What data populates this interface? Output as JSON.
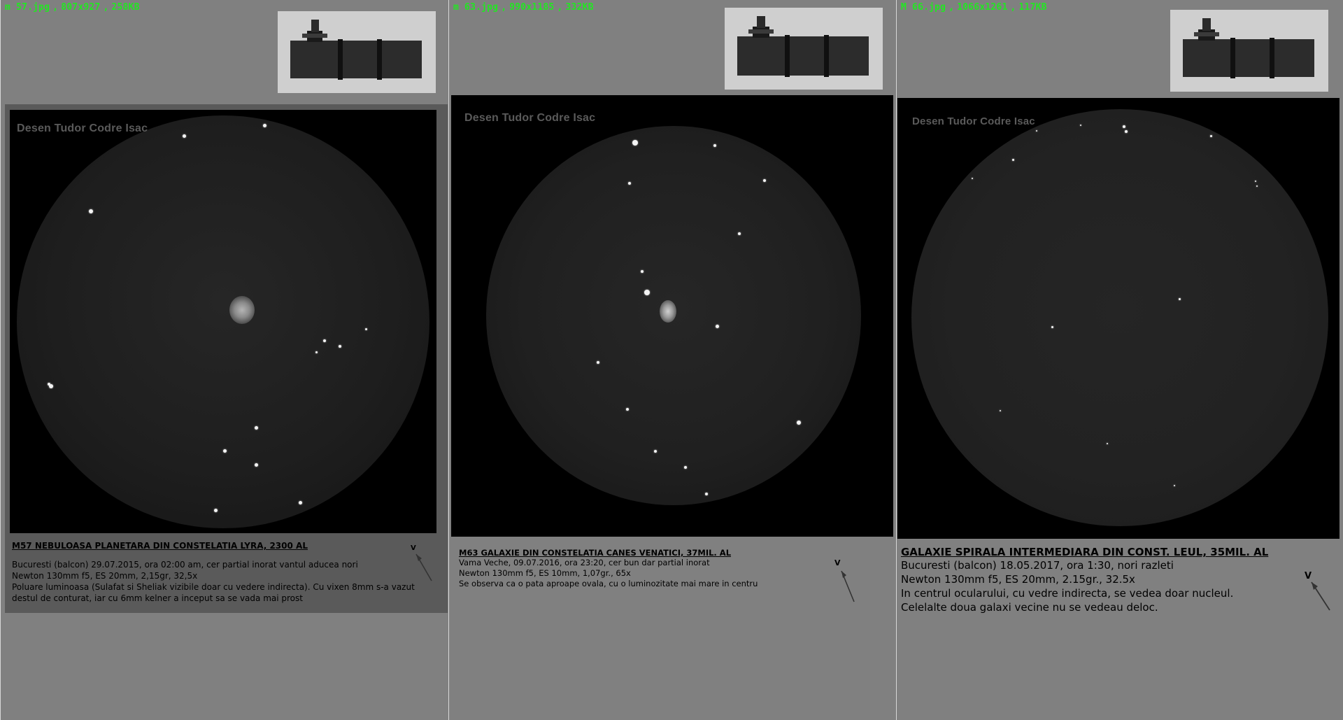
{
  "panels": [
    {
      "file_info": {
        "name": "m 57.jpg",
        "dims": "807x927",
        "size": "258KB"
      },
      "watermark": "Desen Tudor Codre Isac",
      "caption": {
        "title": "M57 NEBULOASA PLANETARA DIN CONSTELATIA LYRA, 2300 AL",
        "line1": "Bucuresti (balcon) 29.07.2015, ora 02:00 am, cer partial inorat vantul aducea nori",
        "line2": "Newton 130mm f5, ES 20mm, 2,15gr, 32,5x",
        "line3": "Poluare luminoasa (Sulafat si Sheliak vizibile doar cu vedere indirecta). Cu vixen 8mm s-a vazut destul de conturat, iar cu 6mm kelner a inceput sa se vada mai prost"
      },
      "v_mark": "V"
    },
    {
      "file_info": {
        "name": "m 63.jpg",
        "dims": "990x1185",
        "size": "332KB"
      },
      "watermark": "Desen Tudor Codre Isac",
      "caption": {
        "title": "M63 GALAXIE DIN CONSTELATIA CANES VENATICI, 37MIL. AL",
        "line1": "Vama Veche, 09.07.2016, ora 23:20, cer bun dar partial inorat",
        "line2": "Newton 130mm f5, ES 10mm, 1,07gr., 65x",
        "line3": "Se observa ca o pata aproape ovala, cu o luminozitate mai mare in centru"
      },
      "v_mark": "V"
    },
    {
      "file_info": {
        "name": "M 66.jpg",
        "dims": "1066x1261",
        "size": "117KB"
      },
      "watermark": "Desen Tudor Codre Isac",
      "caption": {
        "title": "GALAXIE SPIRALA INTERMEDIARA DIN CONST. LEUL, 35MIL. AL",
        "line1": "Bucuresti (balcon) 18.05.2017, ora 1:30, nori razleti",
        "line2": "Newton 130mm f5, ES 20mm, 2.15gr., 32.5x",
        "line3": "In centrul ocularului, cu vedre indirecta, se vedea doar nucleul.",
        "line4": "Celelalte doua galaxi vecine  nu se vedeau deloc."
      },
      "v_mark": "V"
    }
  ],
  "separator": ","
}
